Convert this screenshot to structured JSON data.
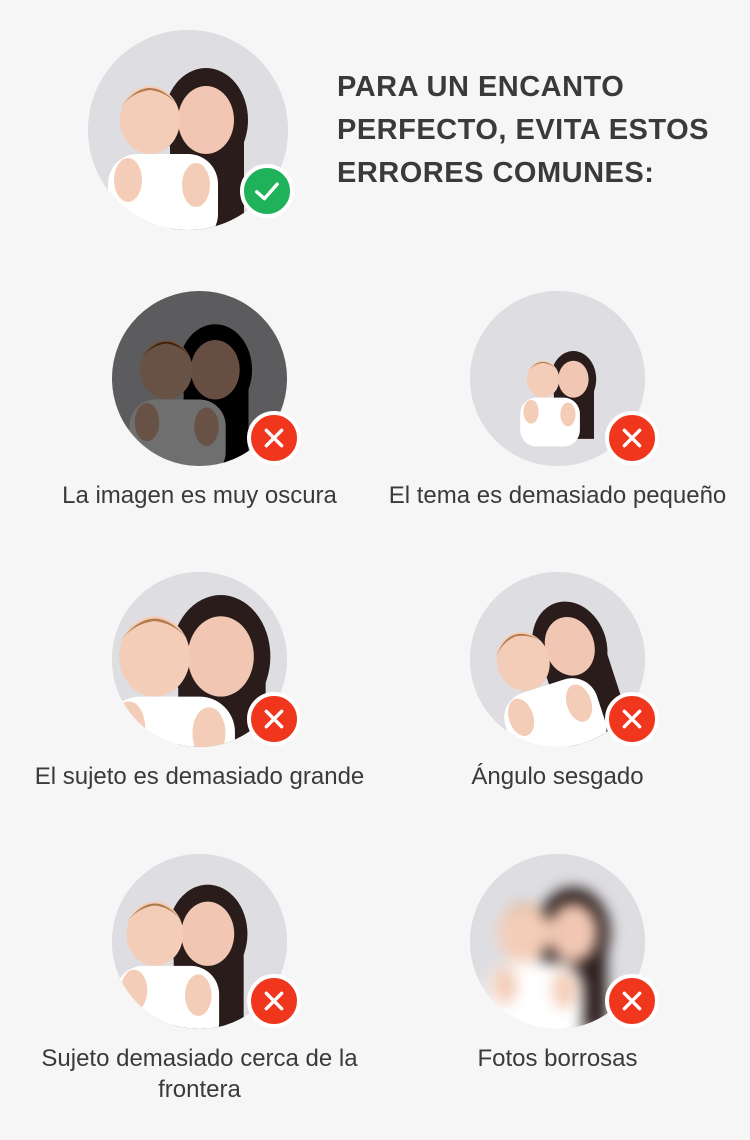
{
  "header": {
    "title_lines": [
      "PARA UN ENCANTO",
      "PERFECTO, EVITA ESTOS",
      "ERRORES COMUNES:"
    ],
    "photo_icon": "mother-child-photo",
    "badge_icon": "check-icon"
  },
  "cards": [
    {
      "caption": "La imagen es muy oscura",
      "variant": "dark"
    },
    {
      "caption": "El tema es demasiado pequeño",
      "variant": "small"
    },
    {
      "caption": "El sujeto es demasiado grande",
      "variant": "large"
    },
    {
      "caption": "Ángulo sesgado",
      "variant": "rotated"
    },
    {
      "caption": "Sujeto demasiado cerca de la frontera",
      "variant": "edge"
    },
    {
      "caption": "Fotos borrosas",
      "variant": "blurred"
    }
  ],
  "colors": {
    "background": "#f6f6f6",
    "ok_badge": "#1fb25a",
    "error_badge": "#f0361d",
    "text": "#3a3a3a"
  },
  "icons": {
    "ok": "check-icon",
    "error": "close-icon"
  }
}
